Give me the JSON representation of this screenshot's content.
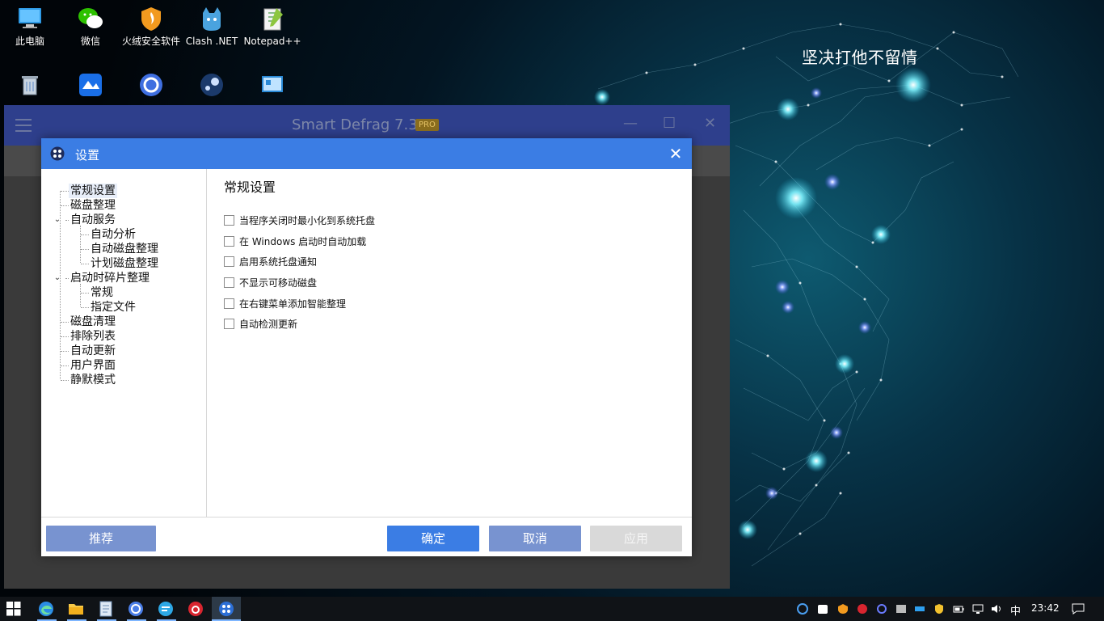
{
  "desktop": {
    "caption": "坚决打他不留情",
    "icons_row1": [
      "此电脑",
      "微信",
      "火绒安全软件",
      "Clash .NET",
      "Notepad++"
    ]
  },
  "background_app": {
    "title": "Smart Defrag 7.3",
    "badge": "PRO"
  },
  "dialog": {
    "title": "设置",
    "tree": [
      "常规设置",
      "磁盘整理",
      "自动服务",
      "自动分析",
      "自动磁盘整理",
      "计划磁盘整理",
      "启动时碎片整理",
      "常规",
      "指定文件",
      "磁盘清理",
      "排除列表",
      "自动更新",
      "用户界面",
      "静默模式"
    ],
    "section_title": "常规设置",
    "options": [
      "当程序关闭时最小化到系统托盘",
      "在 Windows 启动时自动加载",
      "启用系统托盘通知",
      "不显示可移动磁盘",
      "在右键菜单添加智能整理",
      "自动检测更新"
    ],
    "buttons": {
      "recommend": "推荐",
      "ok": "确定",
      "cancel": "取消",
      "apply": "应用"
    }
  },
  "taskbar": {
    "ime": "中",
    "clock": "23:42"
  },
  "colors": {
    "dialog_title": "#3b7de4",
    "ok_button": "#3b7de4",
    "cancel_button": "#7893d0",
    "recommend_button": "#7893d0",
    "apply_disabled": "#d9d9d9"
  }
}
